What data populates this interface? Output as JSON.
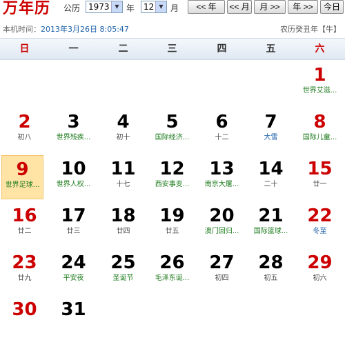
{
  "header": {
    "title": "万年历",
    "calendar_label": "公历",
    "year_value": "1973",
    "year_label": "年",
    "month_value": "12",
    "month_label": "月",
    "buttons": {
      "prev_year": "<< 年",
      "prev_month": "<< 月",
      "next_month": "月 >>",
      "next_year": "年 >>",
      "today": "今日"
    }
  },
  "subheader": {
    "local_time_label": "本机时间：",
    "local_time_value": "2013年3月26日 8:05:47",
    "lunar_year": "农历癸丑年【牛】"
  },
  "weekdays": [
    "日",
    "一",
    "二",
    "三",
    "四",
    "五",
    "六"
  ],
  "colors": {
    "red": "#cc0000",
    "green": "#1a7a1a",
    "blue": "#1a5fa8",
    "gray": "#444444",
    "today_bg": "#ffe4a6"
  },
  "days": [
    {
      "day": "1",
      "sub": "世界艾滋...",
      "sub_color": "green",
      "red": true
    },
    {
      "day": "2",
      "sub": "初八",
      "sub_color": "gray",
      "red": true
    },
    {
      "day": "3",
      "sub": "世界残疾...",
      "sub_color": "green"
    },
    {
      "day": "4",
      "sub": "初十",
      "sub_color": "gray"
    },
    {
      "day": "5",
      "sub": "国际经济...",
      "sub_color": "green"
    },
    {
      "day": "6",
      "sub": "十二",
      "sub_color": "gray"
    },
    {
      "day": "7",
      "sub": "大雪",
      "sub_color": "blue"
    },
    {
      "day": "8",
      "sub": "国际儿童...",
      "sub_color": "green",
      "red": true
    },
    {
      "day": "9",
      "sub": "世界足球...",
      "sub_color": "green",
      "red": true,
      "today": true
    },
    {
      "day": "10",
      "sub": "世界人权...",
      "sub_color": "green"
    },
    {
      "day": "11",
      "sub": "十七",
      "sub_color": "gray"
    },
    {
      "day": "12",
      "sub": "西安事变...",
      "sub_color": "green"
    },
    {
      "day": "13",
      "sub": "南京大屠...",
      "sub_color": "green"
    },
    {
      "day": "14",
      "sub": "二十",
      "sub_color": "gray"
    },
    {
      "day": "15",
      "sub": "廿一",
      "sub_color": "gray",
      "red": true
    },
    {
      "day": "16",
      "sub": "廿二",
      "sub_color": "gray",
      "red": true
    },
    {
      "day": "17",
      "sub": "廿三",
      "sub_color": "gray"
    },
    {
      "day": "18",
      "sub": "廿四",
      "sub_color": "gray"
    },
    {
      "day": "19",
      "sub": "廿五",
      "sub_color": "gray"
    },
    {
      "day": "20",
      "sub": "澳门回归...",
      "sub_color": "green"
    },
    {
      "day": "21",
      "sub": "国际篮球...",
      "sub_color": "green"
    },
    {
      "day": "22",
      "sub": "冬至",
      "sub_color": "blue",
      "red": true
    },
    {
      "day": "23",
      "sub": "廿九",
      "sub_color": "gray",
      "red": true
    },
    {
      "day": "24",
      "sub": "平安夜",
      "sub_color": "green"
    },
    {
      "day": "25",
      "sub": "圣诞节",
      "sub_color": "green"
    },
    {
      "day": "26",
      "sub": "毛泽东诞...",
      "sub_color": "green"
    },
    {
      "day": "27",
      "sub": "初四",
      "sub_color": "gray"
    },
    {
      "day": "28",
      "sub": "初五",
      "sub_color": "gray"
    },
    {
      "day": "29",
      "sub": "初六",
      "sub_color": "gray",
      "red": true
    },
    {
      "day": "30",
      "sub": "",
      "sub_color": "gray",
      "red": true
    },
    {
      "day": "31",
      "sub": "",
      "sub_color": "gray"
    }
  ]
}
